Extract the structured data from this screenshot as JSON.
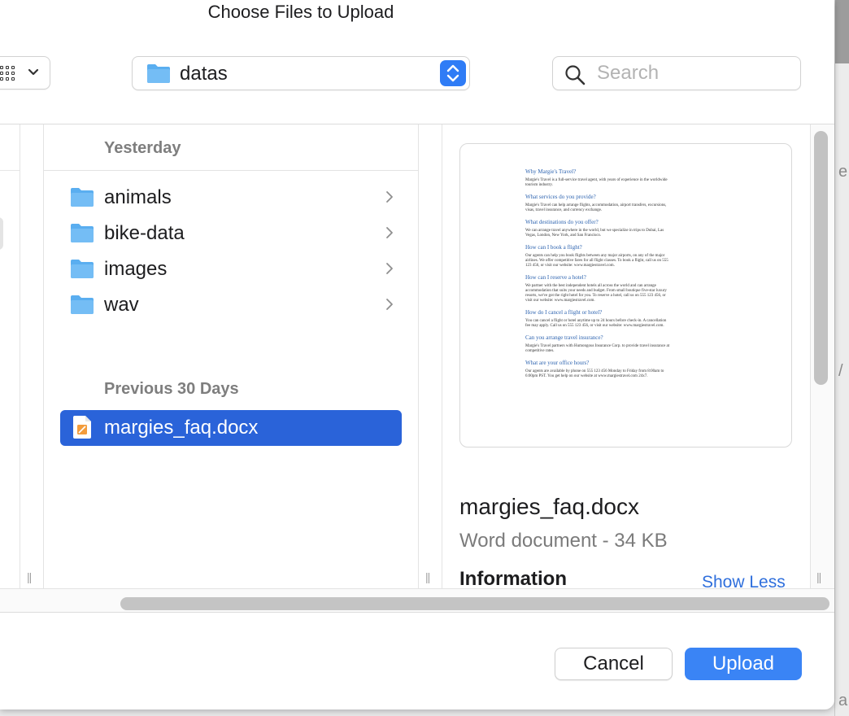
{
  "dialog": {
    "title": "Choose Files to Upload"
  },
  "toolbar": {
    "current_folder": "datas",
    "search": {
      "placeholder": "Search",
      "value": ""
    }
  },
  "browser": {
    "sections": [
      {
        "header": "Yesterday"
      },
      {
        "header": "Previous 30 Days"
      }
    ],
    "folders": [
      {
        "name": "animals",
        "icon": "folder-icon"
      },
      {
        "name": "bike-data",
        "icon": "folder-icon"
      },
      {
        "name": "images",
        "icon": "folder-icon"
      },
      {
        "name": "wav",
        "icon": "folder-icon"
      }
    ],
    "files": [
      {
        "name": "margies_faq.docx",
        "icon": "word-document-icon",
        "selected": true
      }
    ]
  },
  "preview": {
    "file_name": "margies_faq.docx",
    "kind_size": "Word document - 34 KB",
    "info_header": "Information",
    "show_less": "Show Less",
    "document": [
      {
        "heading": "Why Margie's Travel?",
        "text": "Margie's Travel is a full-service travel agent, with years of experience in the worldwide tourism industry."
      },
      {
        "heading": "What services do you provide?",
        "text": "Margie's Travel can help arrange flights, accommodation, airport transfers, excursions, visas, travel insurance, and currency exchange."
      },
      {
        "heading": "What destinations do you offer?",
        "text": "We can arrange travel anywhere in the world, but we specialize in trips to Dubai, Las Vegas, London, New York, and San Francisco."
      },
      {
        "heading": "How can I book a flight?",
        "text": "Our agents can help you book flights between any major airports, on any of the major airlines. We offer competitive fares for all flight classes. To book a flight, call us on 555 123 456, or visit our website: www.margiestravel.com."
      },
      {
        "heading": "How can I reserve a hotel?",
        "text": "We partner with the best independent hotels all across the world and can arrange accommodation that suits your needs and budget. From small boutique five-star luxury resorts, we've got the right hotel for you. To reserve a hotel, call us on 555 123 456, or visit our website: www.margiestravel.com."
      },
      {
        "heading": "How do I cancel a flight or hotel?",
        "text": "You can cancel a flight or hotel anytime up to 24 hours before check-in. A cancellation fee may apply. Call us on 555 123 456, or visit our website: www.margiestravel.com."
      },
      {
        "heading": "Can you arrange travel insurance?",
        "text": "Margie's Travel partners with Humongous Insurance Corp. to provide travel insurance at competitive rates."
      },
      {
        "heading": "What are your office hours?",
        "text": "Our agents are available by phone on 555 123 456 Monday to Friday from 8:00am to 6:00pm PST. You get help on our website at www.margiestravel.com 24x7."
      }
    ]
  },
  "footer": {
    "cancel_label": "Cancel",
    "upload_label": "Upload"
  },
  "colors": {
    "accent": "#3a84f5",
    "selection": "#2a63d9",
    "folder": "#5aaef0",
    "link": "#2f6fdc"
  }
}
